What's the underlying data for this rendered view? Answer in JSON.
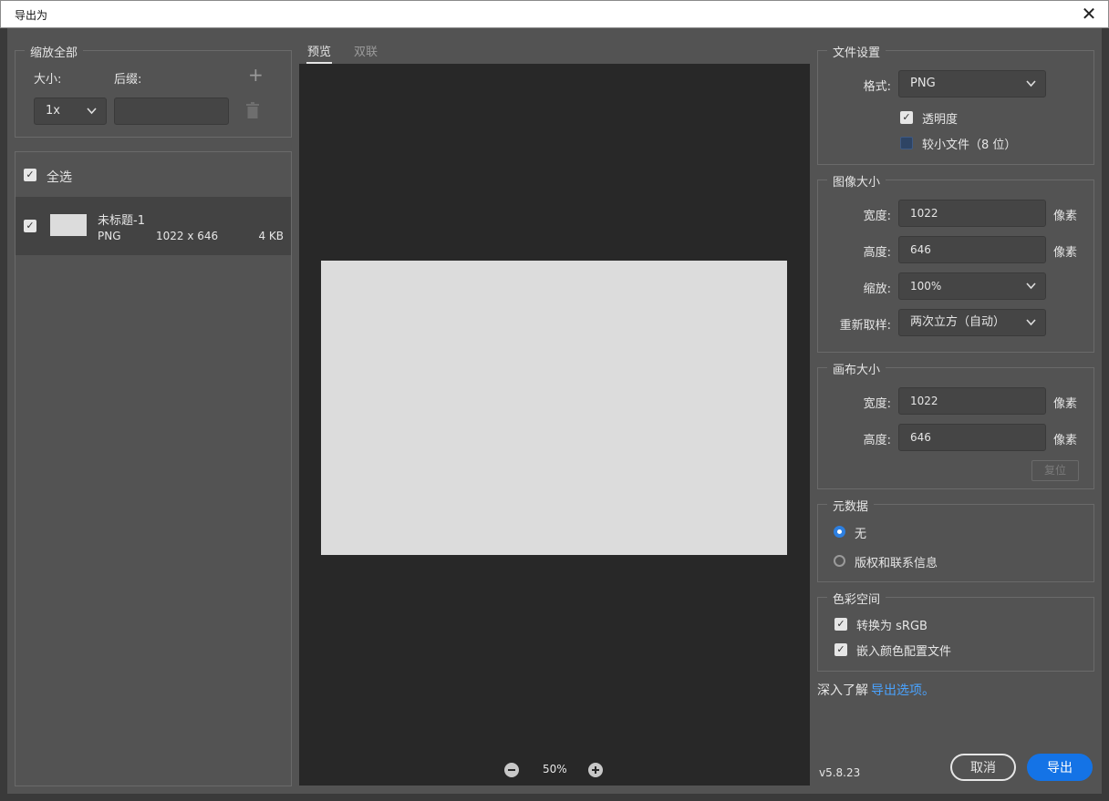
{
  "window": {
    "title": "导出为"
  },
  "scale_all": {
    "legend": "缩放全部",
    "size_label": "大小:",
    "suffix_label": "后缀:",
    "size_value": "1x",
    "suffix_value": ""
  },
  "assets": {
    "select_all_label": "全选",
    "items": [
      {
        "name": "未标题-1",
        "format": "PNG",
        "dimensions": "1022 x 646",
        "size": "4 KB"
      }
    ]
  },
  "preview": {
    "tabs": [
      {
        "label": "预览",
        "active": true
      },
      {
        "label": "双联",
        "active": false
      }
    ],
    "zoom": "50%"
  },
  "file_settings": {
    "legend": "文件设置",
    "format_label": "格式:",
    "format_value": "PNG",
    "transparency_label": "透明度",
    "smaller_file_label": "较小文件（8 位）"
  },
  "image_size": {
    "legend": "图像大小",
    "width_label": "宽度:",
    "width_value": "1022",
    "height_label": "高度:",
    "height_value": "646",
    "scale_label": "缩放:",
    "scale_value": "100%",
    "resample_label": "重新取样:",
    "resample_value": "两次立方（自动）",
    "unit": "像素"
  },
  "canvas_size": {
    "legend": "画布大小",
    "width_label": "宽度:",
    "width_value": "1022",
    "height_label": "高度:",
    "height_value": "646",
    "unit": "像素",
    "reset_label": "复位"
  },
  "metadata": {
    "legend": "元数据",
    "options": [
      {
        "label": "无",
        "selected": true
      },
      {
        "label": "版权和联系信息",
        "selected": false
      }
    ]
  },
  "color_space": {
    "legend": "色彩空间",
    "convert_label": "转换为 sRGB",
    "embed_label": "嵌入颜色配置文件"
  },
  "learn_more": {
    "prefix": "深入了解",
    "link": "导出选项。"
  },
  "footer": {
    "version": "v5.8.23",
    "cancel_label": "取消",
    "export_label": "导出"
  },
  "colors": {
    "accent": "#1473e6",
    "link": "#4aa3ff",
    "preview_bg": "#282828",
    "canvas": "#dcdcdc"
  }
}
